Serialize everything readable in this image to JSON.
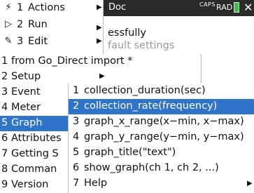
{
  "document": {
    "title": "Doc",
    "caps_indicator": "CAPS",
    "angle_mode": "RAD",
    "close_glyph": "✕",
    "body_line1": "essfully",
    "body_line2": "fault settings"
  },
  "menu1": {
    "items": [
      {
        "icon": "⚡",
        "icon_name": "lightning-icon",
        "num": "1",
        "label": "Actions",
        "submenu": true
      },
      {
        "icon": "▷",
        "icon_name": "play-icon",
        "num": "2",
        "label": "Run",
        "submenu": true
      },
      {
        "icon": "✎",
        "icon_name": "edit-icon",
        "num": "3",
        "label": "Edit",
        "submenu": true
      }
    ]
  },
  "menu2": {
    "items": [
      {
        "num": "1",
        "label": "from Go_Direct import *",
        "submenu": false
      },
      {
        "num": "2",
        "label": "Setup",
        "submenu": true
      },
      {
        "num": "3",
        "label": "Event",
        "submenu": false
      },
      {
        "num": "4",
        "label": "Meter",
        "submenu": false
      },
      {
        "num": "5",
        "label": "Graph",
        "submenu": false,
        "selected": true
      },
      {
        "num": "6",
        "label": "Attributes",
        "submenu": false
      },
      {
        "num": "7",
        "label": "Getting S",
        "submenu": false
      },
      {
        "num": "8",
        "label": "Comman",
        "submenu": false
      },
      {
        "num": "9",
        "label": "Version",
        "submenu": false
      }
    ]
  },
  "menu3": {
    "items": [
      {
        "num": "1",
        "label": "collection_duration(sec)"
      },
      {
        "num": "2",
        "label": "collection_rate(frequency)",
        "selected": true
      },
      {
        "num": "3",
        "label": "graph_x_range(x−min, x−max)"
      },
      {
        "num": "4",
        "label": "graph_y_range(y−min, y−max)"
      },
      {
        "num": "5",
        "label": "graph_title(\"text\")"
      },
      {
        "num": "6",
        "label": "show_graph(ch 1, ch 2, ...)"
      },
      {
        "num": "7",
        "label": "Help",
        "submenu": true
      }
    ]
  },
  "colors": {
    "selection": "#2f74c8",
    "titlebar": "#2a2a2a",
    "battery": "#3bbf4a"
  }
}
